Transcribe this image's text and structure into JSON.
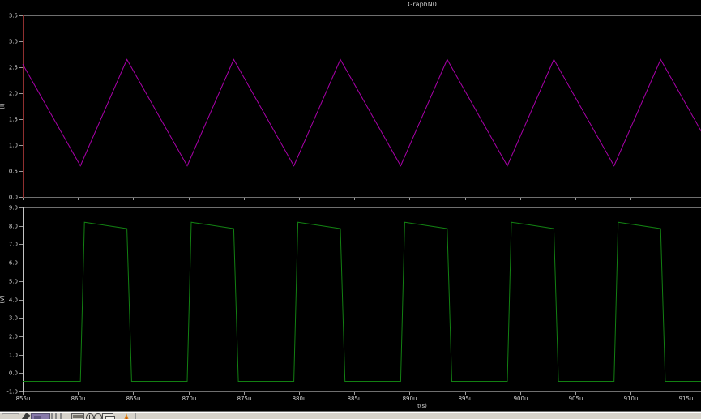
{
  "window": {
    "title": "GraphN0"
  },
  "colors": {
    "background": "#000000",
    "frame": "#6f6f6f",
    "tick_text": "#d4d4d4",
    "title_text": "#cfcfcf",
    "top_chart_axis": "#8f2f2f",
    "bottom_chart_axis": "#c4c4c4",
    "triangle_trace": "#aa00aa",
    "square_trace": "#128012",
    "taskbar_bg": "#d6d2ca"
  },
  "xticks": [
    {
      "t": 855,
      "label": "855u"
    },
    {
      "t": 860,
      "label": "860u"
    },
    {
      "t": 865,
      "label": "865u"
    },
    {
      "t": 870,
      "label": "870u"
    },
    {
      "t": 875,
      "label": "875u"
    },
    {
      "t": 880,
      "label": "880u"
    },
    {
      "t": 885,
      "label": "885u"
    },
    {
      "t": 890,
      "label": "890u"
    },
    {
      "t": 895,
      "label": "895u"
    },
    {
      "t": 900,
      "label": "900u"
    },
    {
      "t": 905,
      "label": "905u"
    },
    {
      "t": 910,
      "label": "910u"
    },
    {
      "t": 915,
      "label": "915u"
    }
  ],
  "chart_data": [
    {
      "type": "line",
      "title": "",
      "ylabel": "(I)",
      "xlabel": "",
      "ylim": [
        0.0,
        3.5
      ],
      "yticks": [
        3.5,
        3.0,
        2.5,
        2.0,
        1.5,
        1.0,
        0.5,
        0.0
      ],
      "x_range_us": [
        855,
        916.5
      ],
      "grid": false,
      "legend": "none",
      "axis_color": "#8f2f2f",
      "show_x_labels": false,
      "series": [
        {
          "name": "triangle-wave-trace",
          "color": "#aa00aa",
          "waveform": "triangle",
          "min_value": 0.6,
          "max_value": 2.65,
          "period_us": 9.66,
          "points_us_v": [
            [
              855,
              2.56
            ],
            [
              860.22,
              0.6
            ],
            [
              864.43,
              2.65
            ],
            [
              869.88,
              0.6
            ],
            [
              874.09,
              2.65
            ],
            [
              879.53,
              0.6
            ],
            [
              883.74,
              2.65
            ],
            [
              889.19,
              0.6
            ],
            [
              893.4,
              2.65
            ],
            [
              898.84,
              0.6
            ],
            [
              903.05,
              2.65
            ],
            [
              908.5,
              0.6
            ],
            [
              912.71,
              2.65
            ],
            [
              916.5,
              1.22
            ]
          ]
        }
      ]
    },
    {
      "type": "line",
      "title": "",
      "ylabel": "(V)",
      "xlabel": "t(s)",
      "ylim": [
        -1.0,
        9.0
      ],
      "yticks": [
        9.0,
        8.0,
        7.0,
        6.0,
        5.0,
        4.0,
        3.0,
        2.0,
        1.0,
        0.0,
        -1.0
      ],
      "x_range_us": [
        855,
        916.5
      ],
      "grid": false,
      "legend": "none",
      "axis_color": "#c4c4c4",
      "show_x_labels": true,
      "series": [
        {
          "name": "square-wave-trace",
          "color": "#128012",
          "waveform": "square",
          "low_value": -0.45,
          "high_start_value": 8.2,
          "high_end_value": 7.85,
          "period_us": 9.66,
          "points_us_v": [
            [
              855,
              -0.45
            ],
            [
              860.22,
              -0.45
            ],
            [
              860.59,
              8.2
            ],
            [
              864.43,
              7.85
            ],
            [
              864.85,
              -0.45
            ],
            [
              869.88,
              -0.45
            ],
            [
              870.25,
              8.2
            ],
            [
              874.09,
              7.85
            ],
            [
              874.51,
              -0.45
            ],
            [
              879.53,
              -0.45
            ],
            [
              879.9,
              8.2
            ],
            [
              883.74,
              7.85
            ],
            [
              884.16,
              -0.45
            ],
            [
              889.19,
              -0.45
            ],
            [
              889.56,
              8.2
            ],
            [
              893.4,
              7.85
            ],
            [
              893.82,
              -0.45
            ],
            [
              898.84,
              -0.45
            ],
            [
              899.21,
              8.2
            ],
            [
              903.05,
              7.85
            ],
            [
              903.47,
              -0.45
            ],
            [
              908.5,
              -0.45
            ],
            [
              908.87,
              8.2
            ],
            [
              912.71,
              7.85
            ],
            [
              913.13,
              -0.45
            ],
            [
              916.5,
              -0.45
            ]
          ]
        }
      ]
    }
  ],
  "taskbar": {
    "icons": [
      {
        "name": "toolbar-button"
      },
      {
        "name": "pen-icon"
      },
      {
        "name": "document-thumbnail-button"
      },
      {
        "name": "faint-text-marks"
      },
      {
        "name": "monitor-icon"
      },
      {
        "name": "zoom-in-icon"
      },
      {
        "name": "zoom-out-icon"
      },
      {
        "name": "cascade-windows-icon"
      },
      {
        "name": "flame-icon"
      }
    ]
  }
}
